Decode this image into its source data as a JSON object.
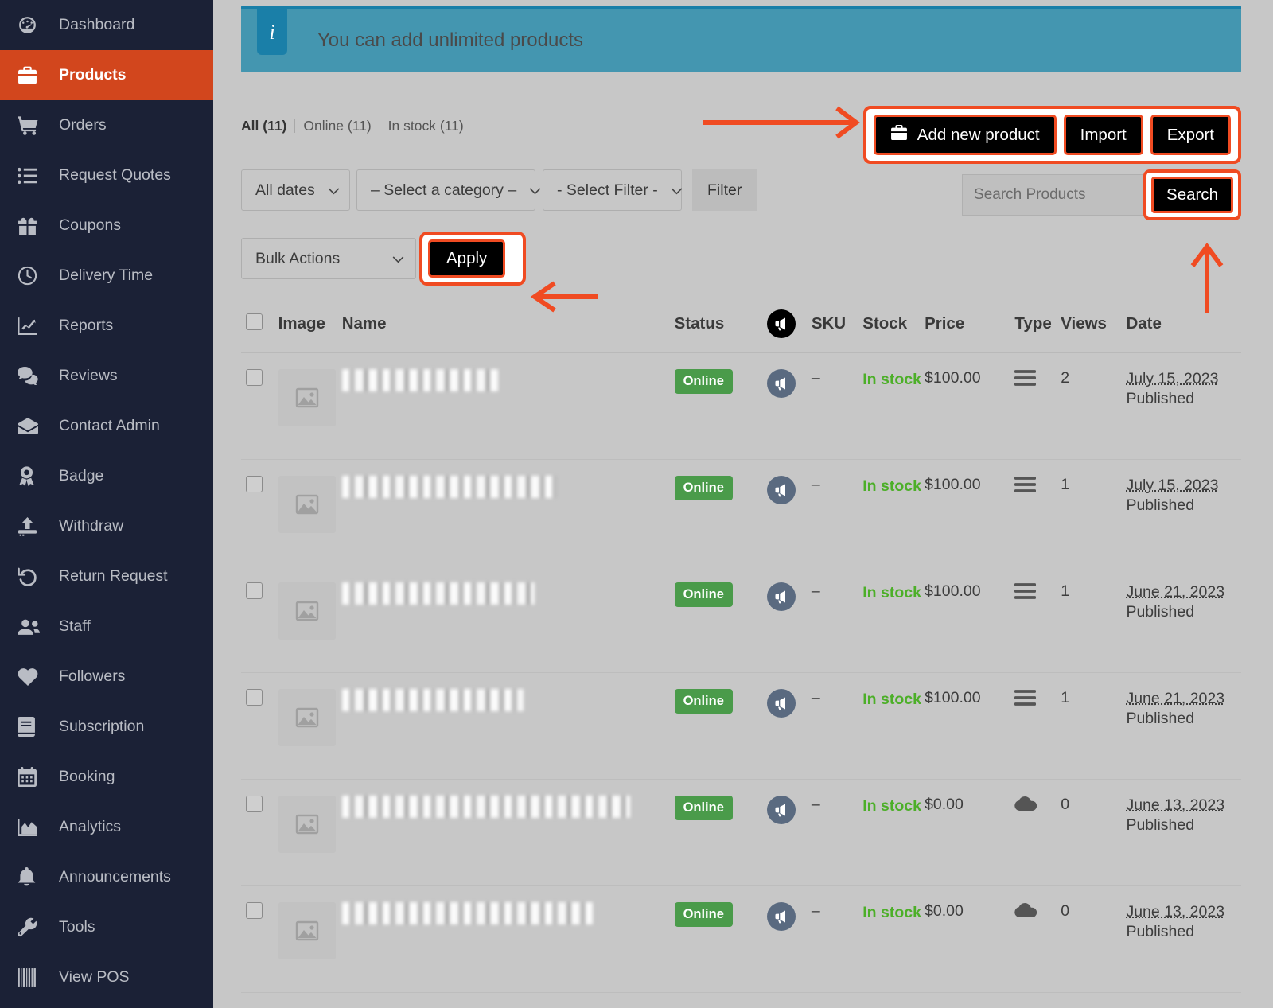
{
  "sidebar": {
    "items": [
      {
        "label": "Dashboard",
        "icon": "gauge-icon",
        "active": false
      },
      {
        "label": "Products",
        "icon": "briefcase-icon",
        "active": true
      },
      {
        "label": "Orders",
        "icon": "cart-icon",
        "active": false
      },
      {
        "label": "Request Quotes",
        "icon": "list-icon",
        "active": false
      },
      {
        "label": "Coupons",
        "icon": "gift-icon",
        "active": false
      },
      {
        "label": "Delivery Time",
        "icon": "clock-icon",
        "active": false
      },
      {
        "label": "Reports",
        "icon": "chart-line-icon",
        "active": false
      },
      {
        "label": "Reviews",
        "icon": "comments-icon",
        "active": false
      },
      {
        "label": "Contact Admin",
        "icon": "envelope-icon",
        "active": false
      },
      {
        "label": "Badge",
        "icon": "award-icon",
        "active": false
      },
      {
        "label": "Withdraw",
        "icon": "upload-icon",
        "active": false
      },
      {
        "label": "Return Request",
        "icon": "undo-icon",
        "active": false
      },
      {
        "label": "Staff",
        "icon": "users-icon",
        "active": false
      },
      {
        "label": "Followers",
        "icon": "heart-icon",
        "active": false
      },
      {
        "label": "Subscription",
        "icon": "book-icon",
        "active": false
      },
      {
        "label": "Booking",
        "icon": "calendar-icon",
        "active": false
      },
      {
        "label": "Analytics",
        "icon": "area-chart-icon",
        "active": false
      },
      {
        "label": "Announcements",
        "icon": "bell-icon",
        "active": false
      },
      {
        "label": "Tools",
        "icon": "wrench-icon",
        "active": false
      },
      {
        "label": "View POS",
        "icon": "barcode-icon",
        "active": false
      }
    ]
  },
  "notice": {
    "icon": "info-icon",
    "badge": "i",
    "text": "You can add unlimited products"
  },
  "tabs": [
    {
      "label": "All (11)"
    },
    {
      "label": "Online (11)"
    },
    {
      "label": "In stock (11)"
    }
  ],
  "page_actions": {
    "add_new_product": "Add new product",
    "add_icon": "briefcase-icon",
    "import": "Import",
    "export": "Export"
  },
  "filters": {
    "date": "All dates",
    "category": "– Select a category –",
    "filter_type": "- Select Filter -",
    "filter_button": "Filter"
  },
  "search": {
    "placeholder": "Search Products",
    "value": "",
    "button": "Search"
  },
  "bulk": {
    "select": "Bulk Actions",
    "apply": "Apply"
  },
  "table": {
    "columns": {
      "checkbox": "",
      "image": "Image",
      "name": "Name",
      "status": "Status",
      "megaphone": "megaphone-icon",
      "sku": "SKU",
      "stock": "Stock",
      "price": "Price",
      "type": "Type",
      "views": "Views",
      "date": "Date"
    },
    "rows": [
      {
        "name_redacted": true,
        "name_width": 196,
        "status": "Online",
        "sku": "–",
        "stock": "In stock",
        "price": "$100.00",
        "type_icon": "bars-icon",
        "views": "2",
        "date": "July 15, 2023",
        "date_status": "Published"
      },
      {
        "name_redacted": true,
        "name_width": 270,
        "status": "Online",
        "sku": "–",
        "stock": "In stock",
        "price": "$100.00",
        "type_icon": "bars-icon",
        "views": "1",
        "date": "July 15, 2023",
        "date_status": "Published"
      },
      {
        "name_redacted": true,
        "name_width": 242,
        "status": "Online",
        "sku": "–",
        "stock": "In stock",
        "price": "$100.00",
        "type_icon": "bars-icon",
        "views": "1",
        "date": "June 21, 2023",
        "date_status": "Published"
      },
      {
        "name_redacted": true,
        "name_width": 228,
        "status": "Online",
        "sku": "–",
        "stock": "In stock",
        "price": "$100.00",
        "type_icon": "bars-icon",
        "views": "1",
        "date": "June 21, 2023",
        "date_status": "Published"
      },
      {
        "name_redacted": true,
        "name_width": 362,
        "status": "Online",
        "sku": "–",
        "stock": "In stock",
        "price": "$0.00",
        "type_icon": "cloud-icon",
        "views": "0",
        "date": "June 13, 2023",
        "date_status": "Published"
      },
      {
        "name_redacted": true,
        "name_width": 316,
        "status": "Online",
        "sku": "–",
        "stock": "In stock",
        "price": "$0.00",
        "type_icon": "cloud-icon",
        "views": "0",
        "date": "June 13, 2023",
        "date_status": "Published"
      }
    ]
  },
  "colors": {
    "sidebar_bg": "#1b2136",
    "accent_active": "#d2461d",
    "annotation": "#f04b22",
    "notice_bg": "#4496b0",
    "notice_accent": "#1a7fa8",
    "status_green": "#4a9b4a",
    "stock_green": "#4caf28",
    "page_bg": "#c7c7c7"
  }
}
